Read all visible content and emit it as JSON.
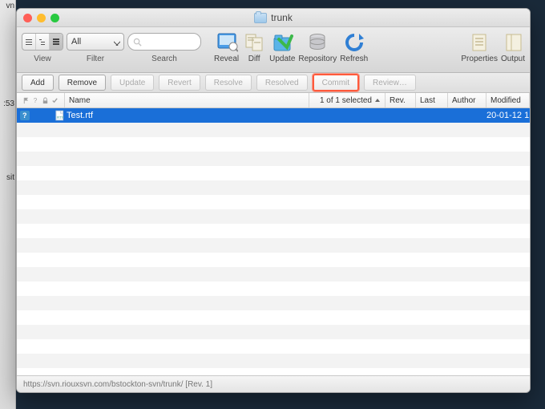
{
  "window": {
    "title": "trunk"
  },
  "toolbar": {
    "view_label": "View",
    "filter_label": "Filter",
    "filter_value": "All",
    "search_label": "Search",
    "reveal": "Reveal",
    "diff": "Diff",
    "update": "Update",
    "repository": "Repository",
    "refresh": "Refresh",
    "properties": "Properties",
    "output": "Output"
  },
  "buttons": {
    "add": "Add",
    "remove": "Remove",
    "update": "Update",
    "revert": "Revert",
    "resolve": "Resolve",
    "resolved": "Resolved",
    "commit": "Commit",
    "review": "Review…"
  },
  "columns": {
    "name": "Name",
    "selected": "1 of 1 selected",
    "rev": "Rev.",
    "last": "Last",
    "author": "Author",
    "modified": "Modified"
  },
  "rows": [
    {
      "badge": "?",
      "name": "Test.rtf",
      "rev": "",
      "last": "",
      "author": "",
      "modified": "20-01-12 1"
    }
  ],
  "status": "https://svn.riouxsvn.com/bstockton-svn/trunk/  [Rev. 1]",
  "bg": {
    "time": ":53",
    "mid": "sit",
    "low": "vn"
  }
}
